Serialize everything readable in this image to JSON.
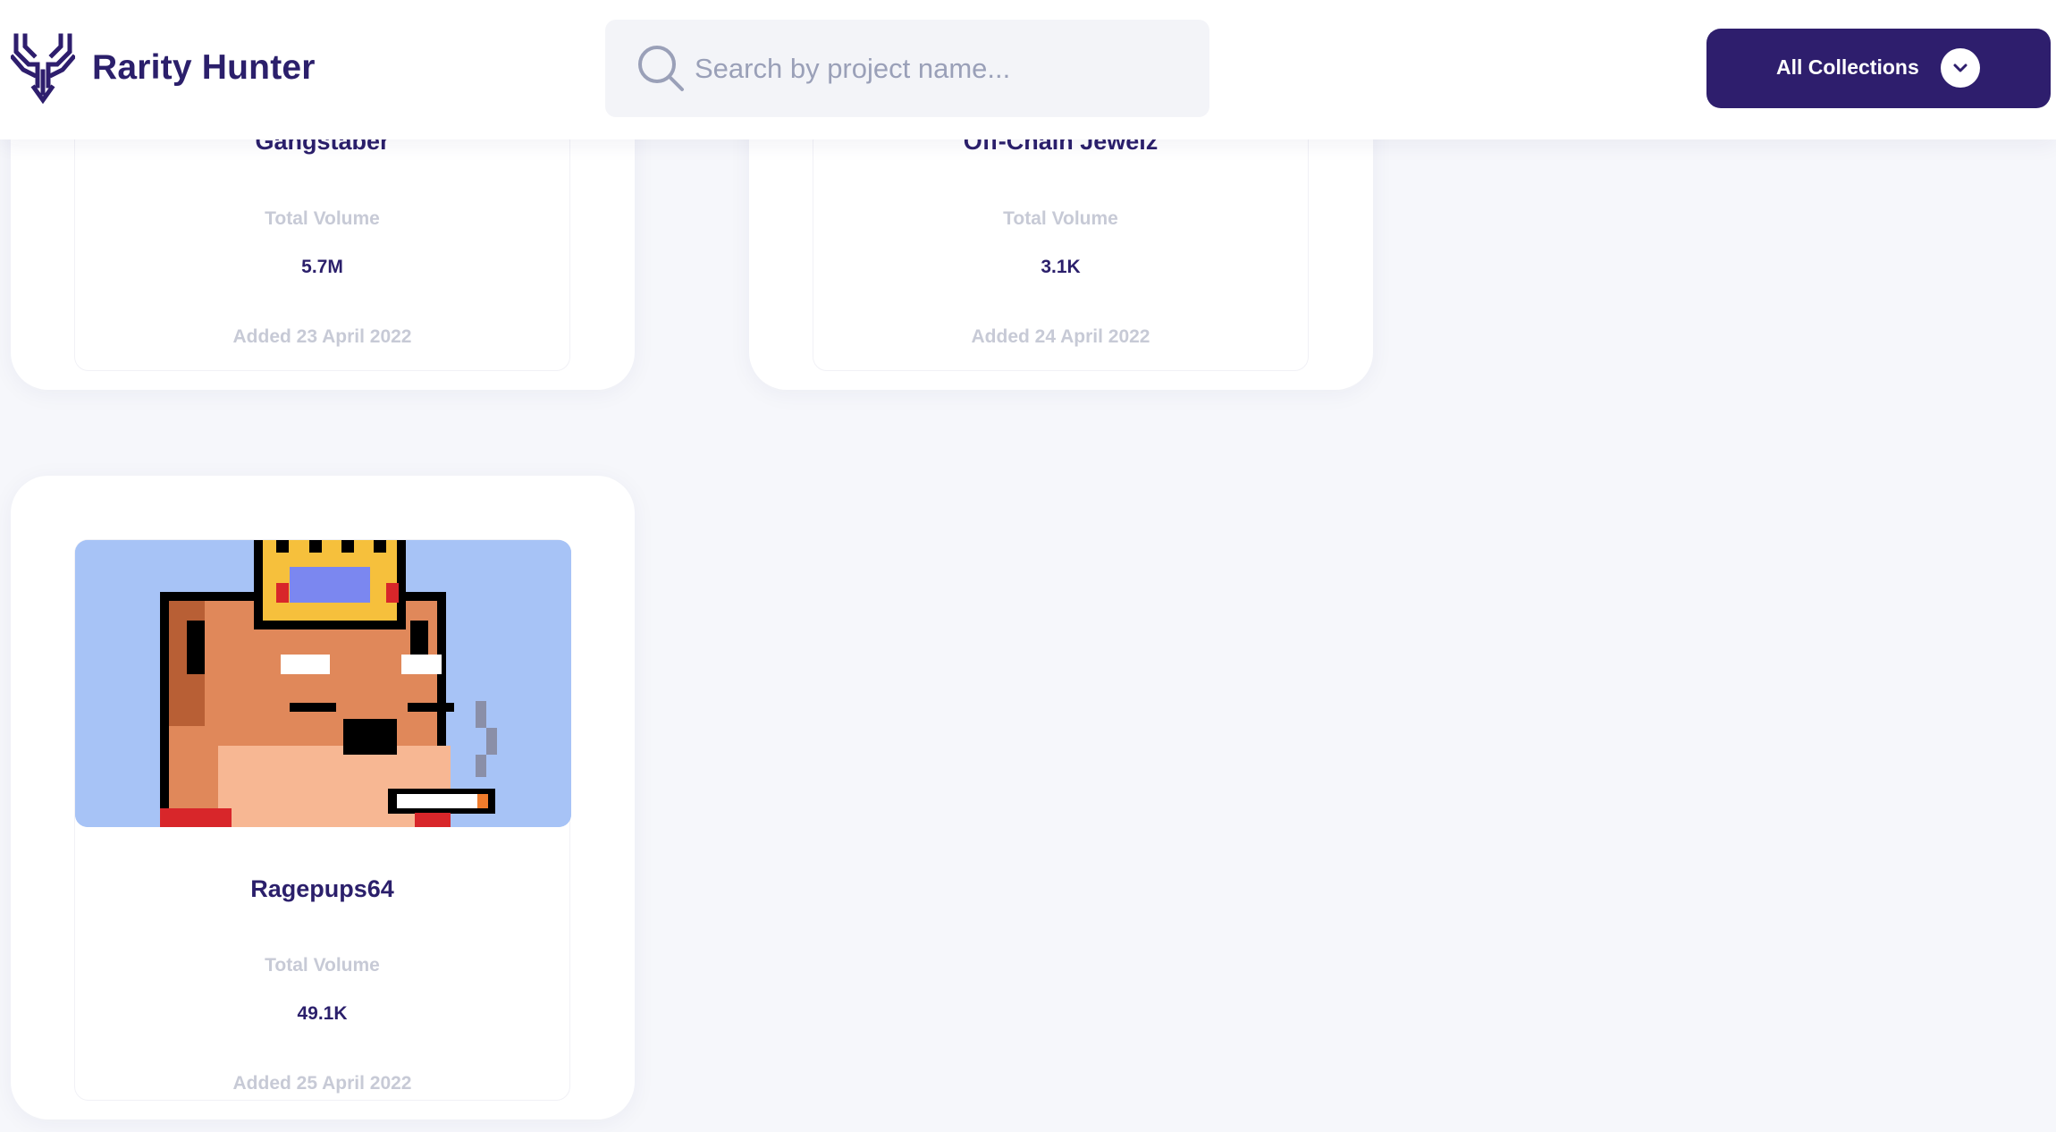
{
  "header": {
    "brand_name": "Rarity Hunter",
    "search_placeholder": "Search by project name...",
    "collections_label": "All Collections",
    "brand_color": "#2e1e6d"
  },
  "cards": [
    {
      "title": "Gangstaber",
      "volume_label": "Total Volume",
      "volume": "5.7M",
      "added": "Added 23 April 2022"
    },
    {
      "title": "Off-Chain Jewelz",
      "volume_label": "Total Volume",
      "volume": "3.1K",
      "added": "Added 24 April 2022"
    },
    {
      "title": "Ragepups64",
      "volume_label": "Total Volume",
      "volume": "49.1K",
      "added": "Added 25 April 2022",
      "image_icon": "pixel-dog-king-icon"
    }
  ]
}
